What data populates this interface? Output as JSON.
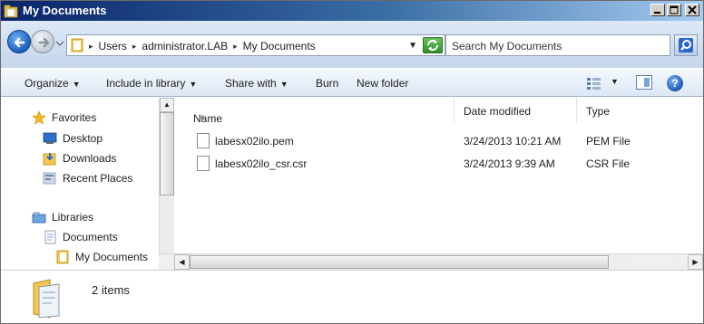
{
  "window": {
    "title": "My Documents",
    "icon": "folder-icon",
    "buttons": [
      "minimize",
      "maximize",
      "close"
    ]
  },
  "address": {
    "crumbs": [
      "Users",
      "administrator.LAB",
      "My Documents"
    ],
    "search_placeholder": "Search My Documents"
  },
  "toolbar": {
    "organize": "Organize",
    "include_in_library": "Include in library",
    "share_with": "Share with",
    "burn": "Burn",
    "new_folder": "New folder"
  },
  "nav": {
    "favorites": "Favorites",
    "desktop": "Desktop",
    "downloads": "Downloads",
    "recent_places": "Recent Places",
    "libraries": "Libraries",
    "documents": "Documents",
    "my_documents": "My Documents"
  },
  "columns": {
    "name": "Name",
    "date_modified": "Date modified",
    "type": "Type"
  },
  "files": [
    {
      "name": "labesx02ilo.pem",
      "date": "3/24/2013 10:21 AM",
      "type": "PEM File"
    },
    {
      "name": "labesx02ilo_csr.csr",
      "date": "3/24/2013 9:39 AM",
      "type": "CSR File"
    }
  ],
  "status": {
    "item_count": "2 items"
  },
  "colors": {
    "accent": "#3a6ea5",
    "titlebar_start": "#0a246a"
  }
}
